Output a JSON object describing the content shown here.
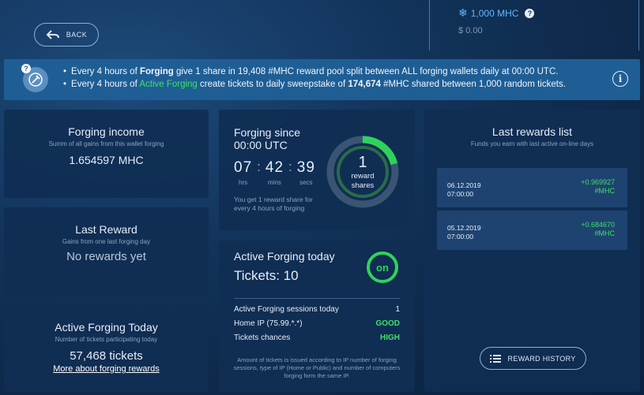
{
  "header": {
    "back_label": "BACK",
    "balance": "1,000 MHC",
    "balance_help": "?",
    "balance_usd": "$ 0.00"
  },
  "banner": {
    "line1_prefix": "Every 4 hours of",
    "line1_bold": "Forging",
    "line1_suffix": "give 1 share in 19,408 #MHC reward pool split between ALL forging wallets daily at 00:00 UTC.",
    "line2_prefix": "Every 4 hours of",
    "line2_green": "Active Forging",
    "line2_mid": "create tickets to daily sweepstake of",
    "line2_bold": "174,674",
    "line2_suffix": "#MHC shared between 1,000 random tickets."
  },
  "forging_income": {
    "title": "Forging income",
    "subtitle": "Summ of all gains from this wallet forging",
    "value": "1.654597 MHC"
  },
  "last_reward": {
    "title": "Last Reward",
    "subtitle": "Gains from one last forging day",
    "value": "No rewards yet"
  },
  "active_today": {
    "title": "Active Forging Today",
    "subtitle": "Number of tickets participating today",
    "value": "57,468 tickets",
    "link": "More about forging rewards"
  },
  "forging_since": {
    "title": "Forging since 00:00 UTC",
    "hrs": "07",
    "mins": "42",
    "secs": "39",
    "hrs_label": "hrs",
    "mins_label": "mins",
    "secs_label": "secs",
    "note": "You get 1 reward share for every 4 hours of forging",
    "shares": "1",
    "shares_label_1": "reward",
    "shares_label_2": "shares",
    "progress": 0.21
  },
  "active_forging": {
    "title": "Active Forging today",
    "tickets": "Tickets: 10",
    "status": "on",
    "rows": [
      {
        "label": "Active Forging sessions today",
        "value": "1"
      },
      {
        "label": "Home IP (75.99.*.*)",
        "value": "GOOD"
      },
      {
        "label": "Tickets chances",
        "value": "HIGH"
      }
    ],
    "note": "Amount of tickets is issued according to IP number of forging sessions, type of IP (Home or Public) and number of computers forging form the same IP."
  },
  "rewards_list": {
    "title": "Last rewards list",
    "subtitle": "Funds you earn with last active on-line days",
    "items": [
      {
        "date": "06.12.2019",
        "time": "07:00:00",
        "amount": "+0.969927",
        "unit": "#MHC"
      },
      {
        "date": "05.12.2019",
        "time": "07:00:00",
        "amount": "+0.684670",
        "unit": "#MHC"
      }
    ],
    "history_label": "REWARD HISTORY"
  },
  "colors": {
    "accent_green": "#3ee066",
    "link_blue": "#5fb6ff",
    "banner_bg": "#1f5e95"
  }
}
